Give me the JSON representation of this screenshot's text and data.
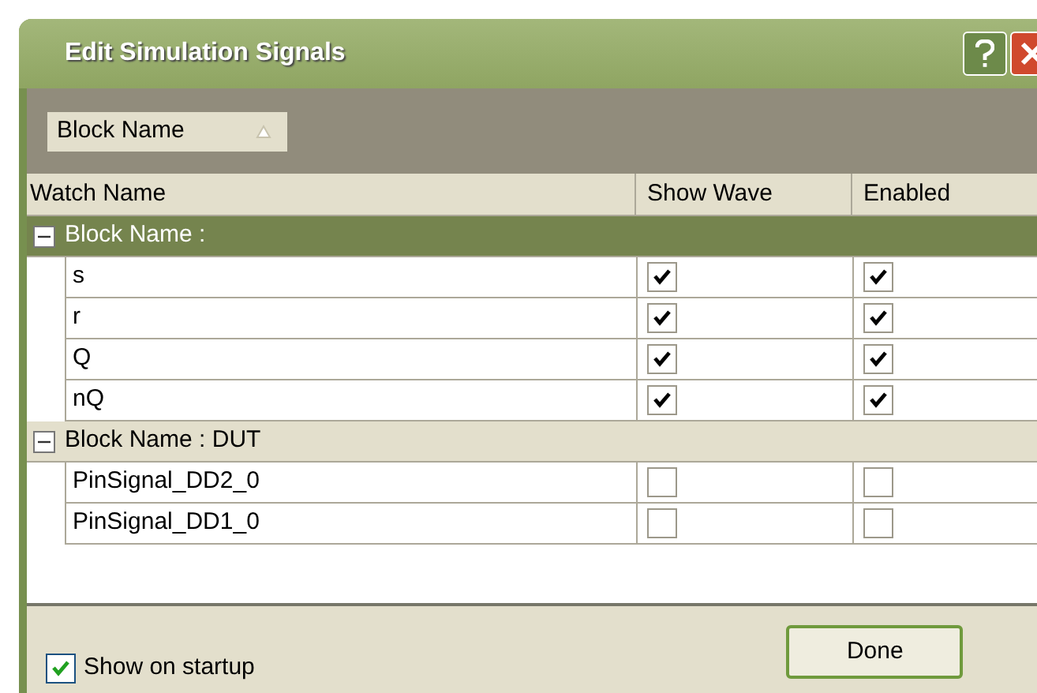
{
  "window": {
    "title": "Edit Simulation Signals"
  },
  "group_by": {
    "label": "Block Name"
  },
  "columns": [
    "Watch Name",
    "Show Wave",
    "Enabled"
  ],
  "groups": [
    {
      "label": "Block Name :",
      "expanded": true,
      "selected": true,
      "rows": [
        {
          "name": "s",
          "show_wave": true,
          "enabled": true
        },
        {
          "name": "r",
          "show_wave": true,
          "enabled": true
        },
        {
          "name": "Q",
          "show_wave": true,
          "enabled": true
        },
        {
          "name": "nQ",
          "show_wave": true,
          "enabled": true
        }
      ]
    },
    {
      "label": "Block Name : DUT",
      "expanded": true,
      "selected": false,
      "rows": [
        {
          "name": "PinSignal_DD2_0",
          "show_wave": false,
          "enabled": false
        },
        {
          "name": "PinSignal_DD1_0",
          "show_wave": false,
          "enabled": false
        }
      ]
    }
  ],
  "show_on_startup": {
    "label": "Show on startup",
    "checked": true
  },
  "done_button": "Done"
}
